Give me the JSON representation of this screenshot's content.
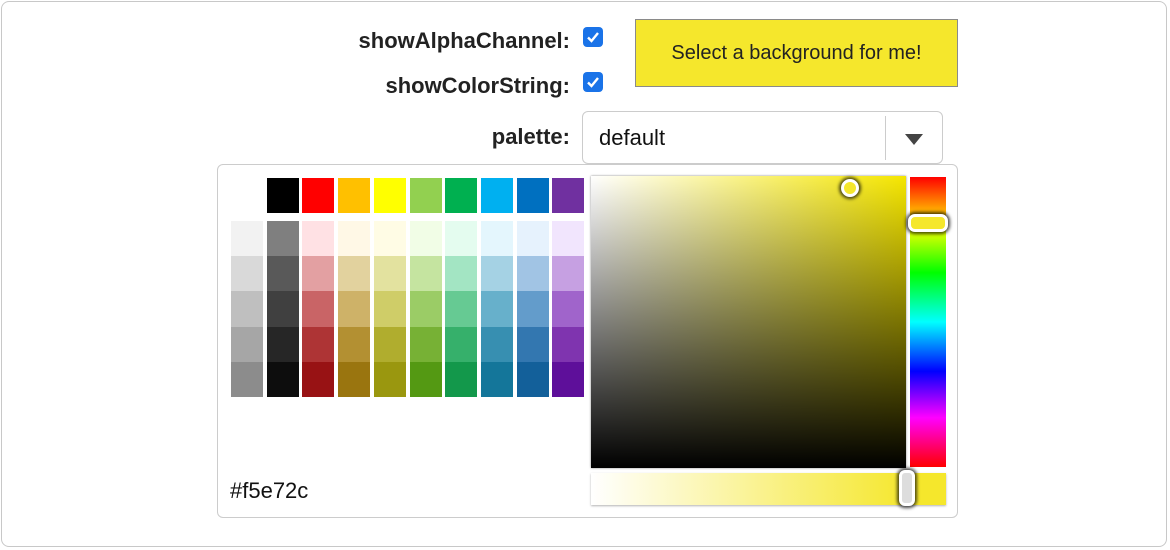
{
  "options": {
    "show_alpha_label": "showAlphaChannel:",
    "show_alpha_checked": true,
    "show_color_string_label": "showColorString:",
    "show_color_string_checked": true,
    "palette_label": "palette:",
    "palette_value": "default"
  },
  "preview": {
    "text": "Select a background for me!",
    "background": "#f5e72c"
  },
  "picker": {
    "color_string": "#f5e72c",
    "hue_position": 0.15,
    "alpha": 1.0,
    "top_row": [
      "#000000",
      "#ff0000",
      "#ffc000",
      "#ffff00",
      "#92d050",
      "#00b050",
      "#00b0f0",
      "#0070c0",
      "#7030a0"
    ],
    "grid": [
      [
        "#f2f2f2",
        "#d9d9d9",
        "#bfbfbf",
        "#a6a6a6",
        "#8c8c8c"
      ],
      [
        "#7f7f7f",
        "#595959",
        "#404040",
        "#262626",
        "#0d0d0d"
      ],
      [
        "#ffe1e4",
        "#e3a0a2",
        "#c96466",
        "#ae3435",
        "#981214"
      ],
      [
        "#fff8e6",
        "#e2d29e",
        "#ceb268",
        "#b39032",
        "#9a750f"
      ],
      [
        "#fffce5",
        "#e3e29f",
        "#cfcd68",
        "#b0ad2e",
        "#9a970f"
      ],
      [
        "#f1fde6",
        "#c5e4a0",
        "#9bcc66",
        "#77b135",
        "#549913"
      ],
      [
        "#e4fcef",
        "#a3e5c3",
        "#66ca93",
        "#36b06b",
        "#13984b"
      ],
      [
        "#e4f6fd",
        "#a5d2e4",
        "#67b0cb",
        "#378fb1",
        "#14769a"
      ],
      [
        "#e6f2fd",
        "#a1c4e4",
        "#639ccb",
        "#3377b0",
        "#13609a"
      ],
      [
        "#f1e5fd",
        "#c6a0e2",
        "#a064cb",
        "#7f34af",
        "#5e0f9a"
      ]
    ]
  }
}
